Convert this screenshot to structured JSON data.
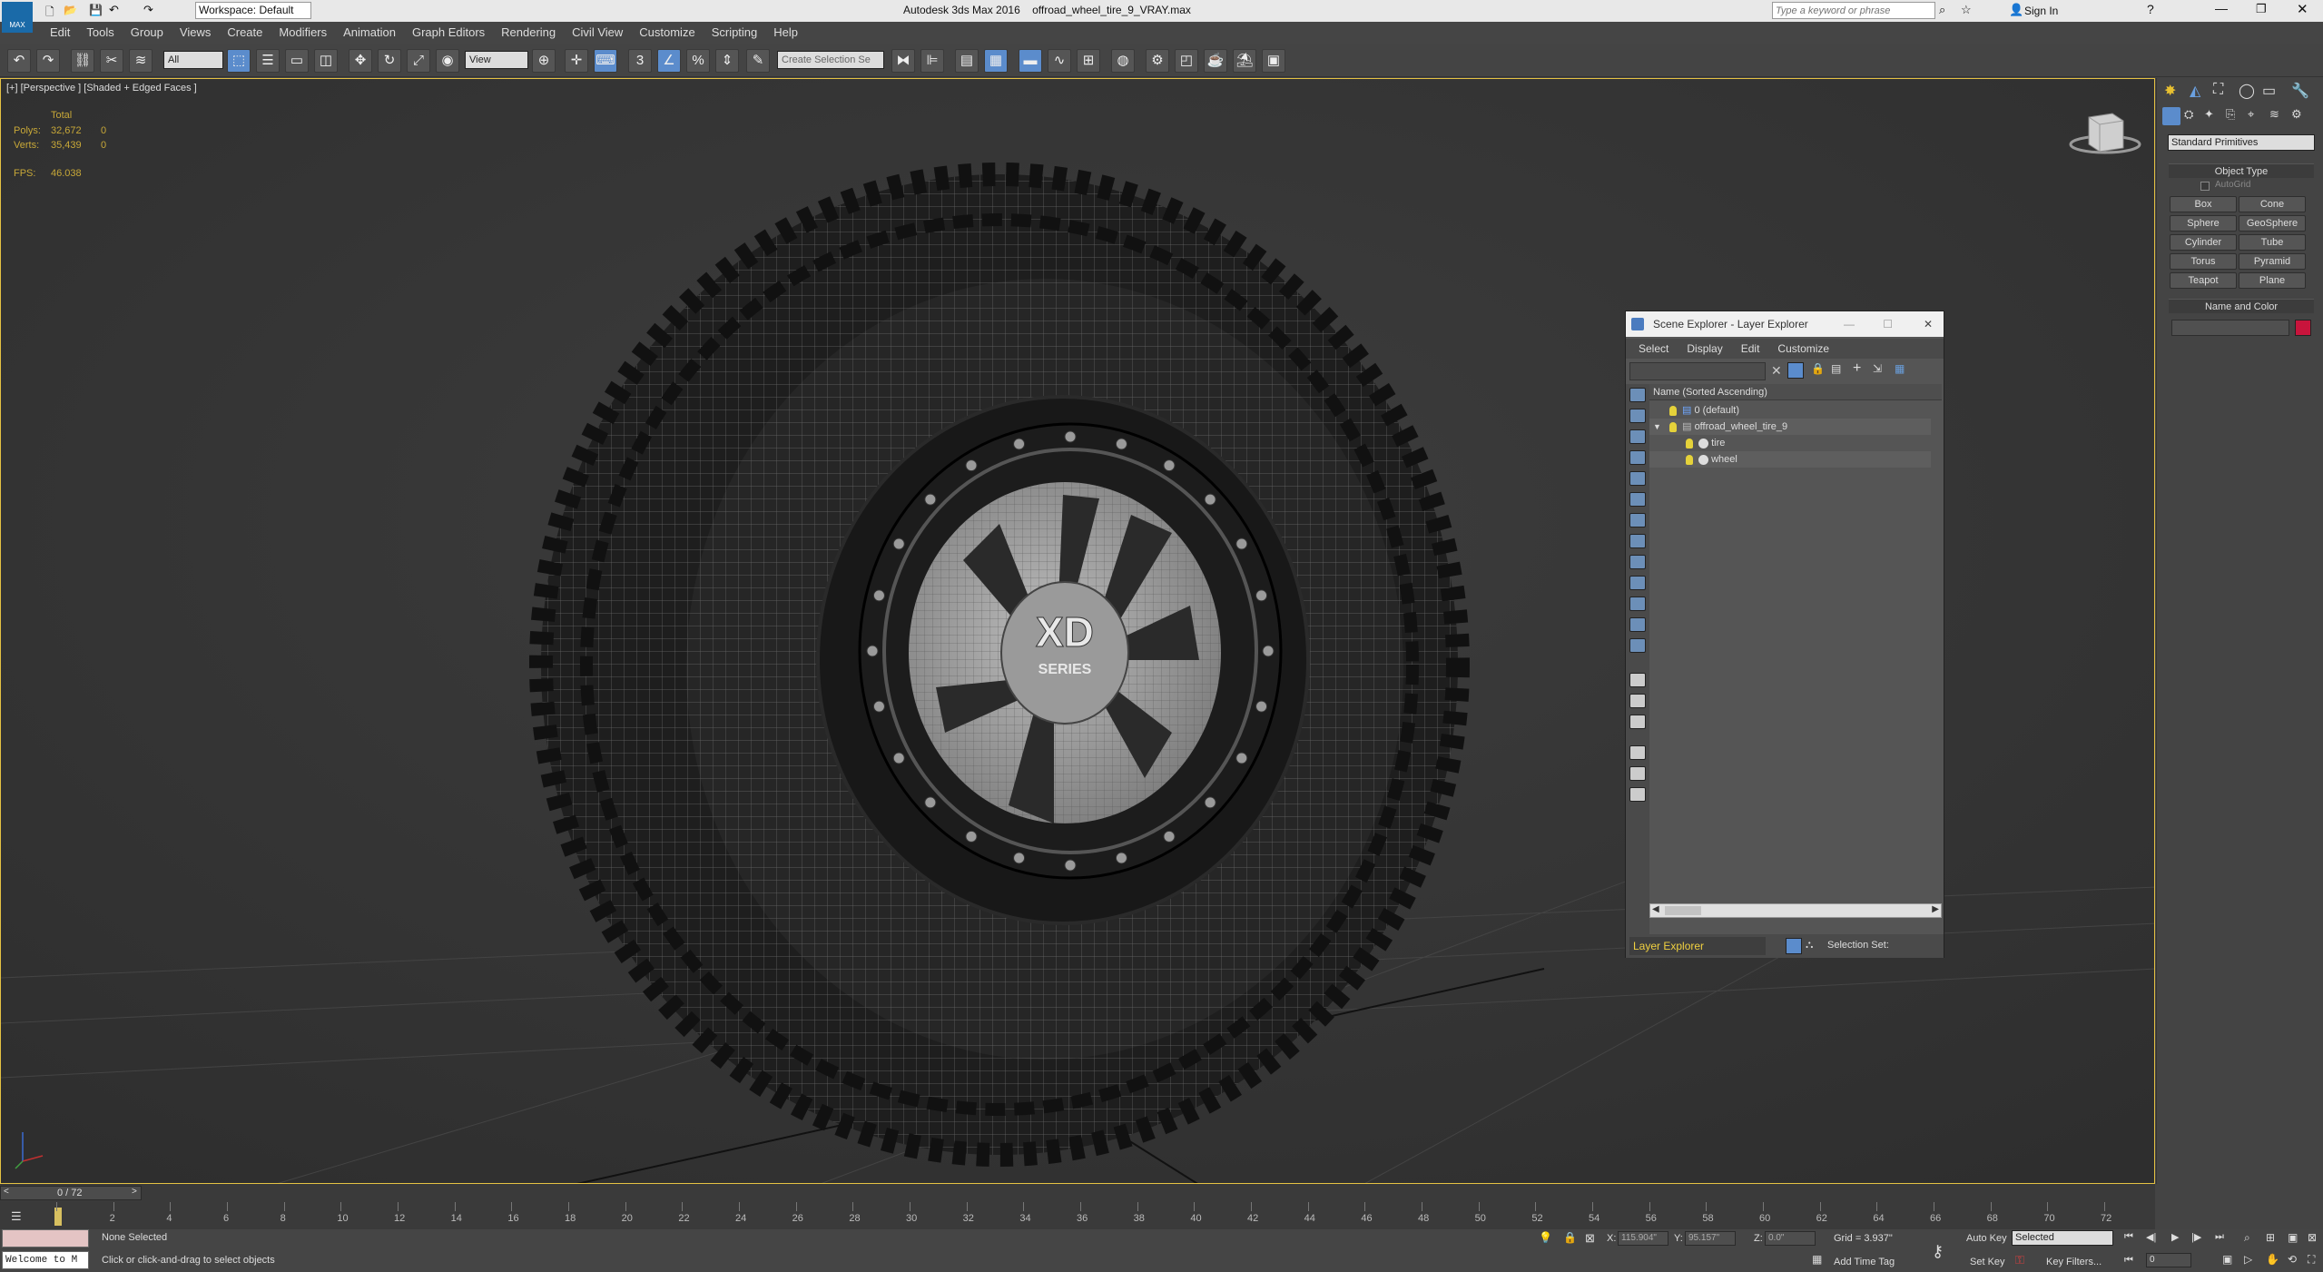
{
  "titlebar": {
    "workspace_label": "Workspace: Default",
    "app_title": "Autodesk 3ds Max 2016",
    "file_name": "offroad_wheel_tire_9_VRAY.max",
    "search_placeholder": "Type a keyword or phrase",
    "sign_in": "Sign In",
    "max_logo": "MAX"
  },
  "menu": [
    "Edit",
    "Tools",
    "Group",
    "Views",
    "Create",
    "Modifiers",
    "Animation",
    "Graph Editors",
    "Rendering",
    "Civil View",
    "Customize",
    "Scripting",
    "Help"
  ],
  "toolbar": {
    "filter_value": "All",
    "refcoord_value": "View",
    "selection_set_placeholder": "Create Selection Se"
  },
  "viewport": {
    "label": "[+] [Perspective ] [Shaded + Edged Faces ]",
    "stats": {
      "total_label": "Total",
      "polys_label": "Polys:",
      "polys_value": "32,672",
      "polys_sel": "0",
      "verts_label": "Verts:",
      "verts_value": "35,439",
      "verts_sel": "0",
      "fps_label": "FPS:",
      "fps_value": "46.038"
    },
    "hub_label": "XD",
    "hub_label2": "SERIES"
  },
  "scene_explorer": {
    "title": "Scene Explorer - Layer Explorer",
    "menus": [
      "Select",
      "Display",
      "Edit",
      "Customize"
    ],
    "column_header": "Name (Sorted Ascending)",
    "rows": [
      {
        "name": "0 (default)",
        "level": 0
      },
      {
        "name": "offroad_wheel_tire_9",
        "level": 0
      },
      {
        "name": "tire",
        "level": 1
      },
      {
        "name": "wheel",
        "level": 1
      }
    ],
    "footer_mode": "Layer Explorer",
    "footer_selection_set": "Selection Set:"
  },
  "command_panel": {
    "dropdown": "Standard Primitives",
    "object_type_title": "Object Type",
    "autogrid_label": "AutoGrid",
    "buttons": [
      "Box",
      "Cone",
      "Sphere",
      "GeoSphere",
      "Cylinder",
      "Tube",
      "Torus",
      "Pyramid",
      "Teapot",
      "Plane"
    ],
    "name_color_title": "Name and Color",
    "object_color": "#c8143c"
  },
  "timeline": {
    "frame_counter": "0 / 72",
    "ticks": [
      "0",
      "2",
      "4",
      "6",
      "8",
      "10",
      "12",
      "14",
      "16",
      "18",
      "20",
      "22",
      "24",
      "26",
      "28",
      "30",
      "32",
      "34",
      "36",
      "38",
      "40",
      "42",
      "44",
      "46",
      "48",
      "50",
      "52",
      "54",
      "56",
      "58",
      "60",
      "62",
      "64",
      "66",
      "68",
      "70",
      "72"
    ]
  },
  "status": {
    "listener_text": "Welcome to M",
    "selection_text": "None Selected",
    "prompt_text": "Click or click-and-drag to select objects",
    "x_label": "X:",
    "x_value": "115.904\"",
    "y_label": "Y:",
    "y_value": "95.157\"",
    "z_label": "Z:",
    "z_value": "0.0\"",
    "grid_text": "Grid = 3.937\"",
    "add_time_tag": "Add Time Tag",
    "auto_key": "Auto Key",
    "set_key": "Set Key",
    "selected_dropdown": "Selected",
    "key_filters": "Key Filters...",
    "frame_field": "0"
  }
}
